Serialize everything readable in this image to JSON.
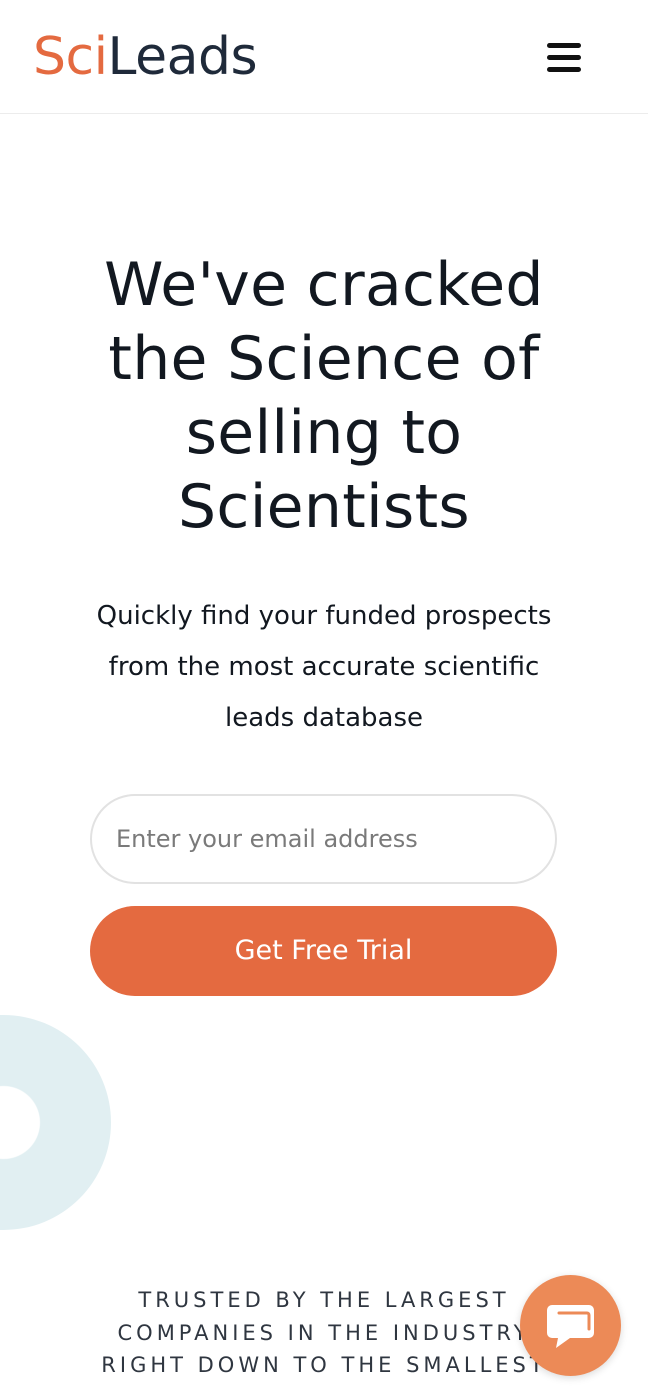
{
  "header": {
    "logo_part1": "Sci",
    "logo_part2": "Leads",
    "menu_icon": "hamburger-menu-icon"
  },
  "hero": {
    "title_lines": [
      "We've cracked",
      "the Science of",
      "selling to",
      "Scientists"
    ],
    "subtitle_lines": [
      "Quickly find your funded prospects",
      "from the most accurate scientific",
      "leads database"
    ]
  },
  "signup": {
    "email_placeholder": "Enter your email address",
    "email_value": "",
    "cta_label": "Get Free Trial"
  },
  "trusted": {
    "lines": [
      "TRUSTED BY THE LARGEST",
      "COMPANIES IN THE INDUSTRY",
      "RIGHT DOWN TO THE SMALLEST"
    ]
  },
  "chat": {
    "icon": "chat-bubble-icon"
  },
  "colors": {
    "brand_orange": "#e46a40",
    "logo_dark": "#1f2a3a",
    "decor_light_blue": "#e1eff2",
    "chat_orange": "#ec8a57"
  }
}
